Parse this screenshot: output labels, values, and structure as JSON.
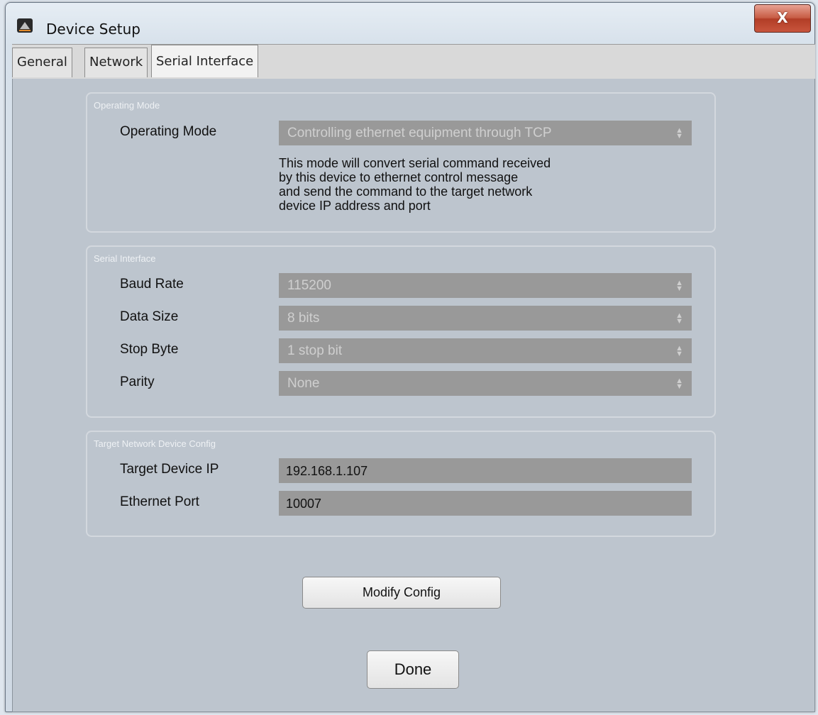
{
  "window": {
    "title": "Device Setup",
    "close_glyph": "X"
  },
  "tabs": [
    {
      "label": "General"
    },
    {
      "label": "Network"
    },
    {
      "label": "Serial Interface",
      "active": true
    }
  ],
  "operating_mode_group": {
    "title": "Operating Mode",
    "mode_label": "Operating Mode",
    "mode_value": "Controlling ethernet equipment through TCP",
    "description": "This mode will convert serial command received\nby this device to ethernet control message\nand send the command to the target network\ndevice IP address and port"
  },
  "serial_group": {
    "title": "Serial Interface",
    "baud_label": "Baud Rate",
    "baud_value": "115200",
    "data_size_label": "Data Size",
    "data_size_value": "8 bits",
    "stop_label": "Stop Byte",
    "stop_value": "1 stop bit",
    "parity_label": "Parity",
    "parity_value": "None"
  },
  "target_group": {
    "title": "Target Network Device Config",
    "ip_label": "Target Device IP",
    "ip_value": "192.168.1.107",
    "port_label": "Ethernet Port",
    "port_value": "10007"
  },
  "buttons": {
    "modify": "Modify Config",
    "done": "Done"
  },
  "icons": {
    "spinner": "updown-arrows-icon",
    "app": "app-logo-icon"
  },
  "colors": {
    "panel": "#bdc5ce",
    "disabled_field": "#999999",
    "close": "#c75c44"
  }
}
